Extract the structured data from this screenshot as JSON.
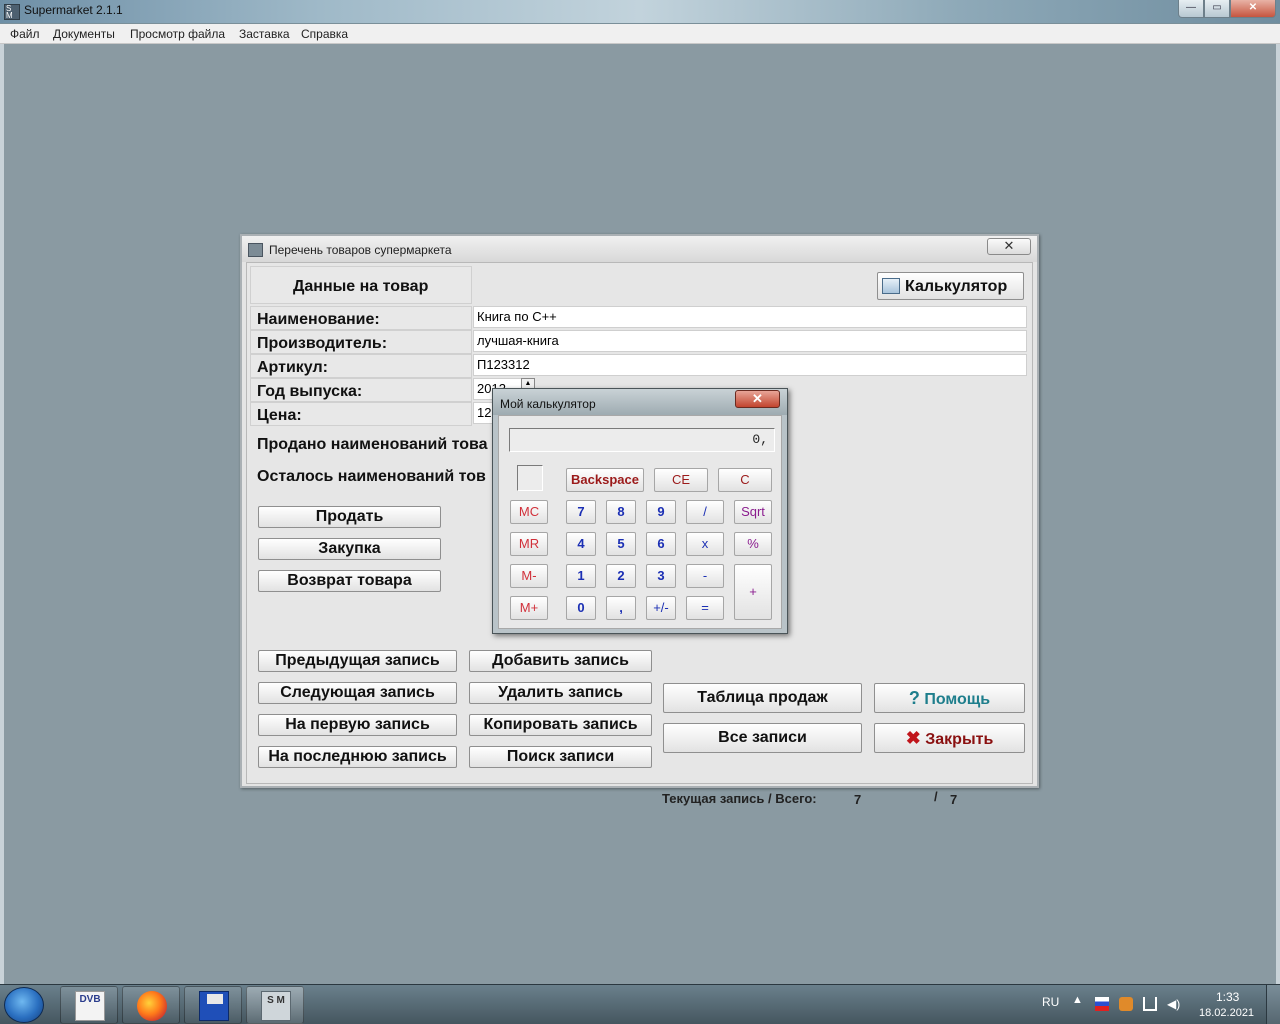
{
  "app": {
    "title": "Supermarket 2.1.1"
  },
  "menu": [
    "Файл",
    "Документы",
    "Просмотр файла",
    "Заставка",
    "Справка"
  ],
  "child": {
    "title": "Перечень товаров супермаркета",
    "header": "Данные на товар",
    "calculator_button": "Калькулятор",
    "labels": {
      "name": "Наименование:",
      "maker": "Производитель:",
      "article": "Артикул:",
      "year": "Год  выпуска:",
      "price": "Цена:",
      "sold": "Продано  наименований  това",
      "left": "Осталось  наименований  тов"
    },
    "values": {
      "name": "Книга по С++",
      "maker": "лучшая-книга",
      "article": "П123312",
      "year": "2012",
      "price": "12,"
    },
    "actions": {
      "sell": "Продать",
      "buy": "Закупка",
      "return": "Возврат  товара"
    },
    "nav": {
      "prev": "Предыдущая  запись",
      "next": "Следующая  запись",
      "first": "На  первую  запись",
      "last": "На  последнюю  запись",
      "add": "Добавить  запись",
      "delete": "Удалить  запись",
      "copy": "Копировать  запись",
      "search": "Поиск  записи",
      "sales_table": "Таблица  продаж",
      "all_records": "Все  записи",
      "help": "Помощь",
      "close": "Закрыть"
    },
    "status": {
      "label": "Текущая  запись / Всего:",
      "current": "7",
      "sep": "/",
      "total": "7"
    }
  },
  "calculator": {
    "title": "Мой  калькулятор",
    "display": "0,",
    "keys": {
      "backspace": "Backspace",
      "ce": "CE",
      "c": "C",
      "mc": "MC",
      "mr": "MR",
      "mminus": "M-",
      "mplus": "M+",
      "d7": "7",
      "d8": "8",
      "d9": "9",
      "div": "/",
      "sqrt": "Sqrt",
      "d4": "4",
      "d5": "5",
      "d6": "6",
      "mul": "x",
      "pct": "%",
      "d1": "1",
      "d2": "2",
      "d3": "3",
      "sub": "-",
      "d0": "0",
      "comma": ",",
      "sign": "+/-",
      "eq": "=",
      "add": "+"
    }
  },
  "taskbar": {
    "dvb": "DVB",
    "sm": "S M",
    "lang": "RU",
    "time": "1:33",
    "date": "18.02.2021"
  }
}
